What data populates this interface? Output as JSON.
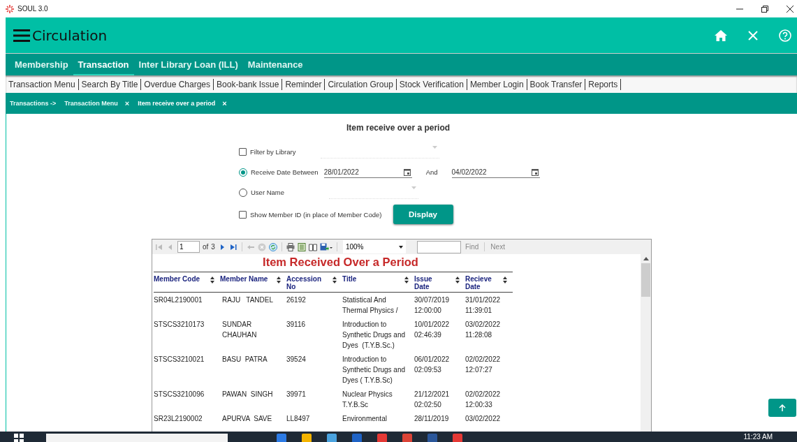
{
  "app_title": "SOUL 3.0",
  "header": {
    "title": "Circulation"
  },
  "main_tabs": [
    {
      "label": "Membership",
      "selected": false
    },
    {
      "label": "Transaction",
      "selected": true
    },
    {
      "label": "Inter Library Loan (ILL)",
      "selected": false
    },
    {
      "label": "Maintenance",
      "selected": false
    }
  ],
  "sub_tabs": [
    "Transaction Menu",
    "Search By Title",
    "Overdue Charges",
    "Book-bank Issue",
    "Reminder",
    "Circulation Group",
    "Stock Verification",
    "Member Login",
    "Book Transfer",
    "Reports"
  ],
  "breadcrumbs": [
    {
      "label": "Transactions ->"
    },
    {
      "label": "Transaction Menu",
      "close": "×"
    },
    {
      "label": "Item receive over a period",
      "close": "×"
    }
  ],
  "form": {
    "title": "Item receive over a period",
    "rows": [
      {
        "kind": "checkbox-select",
        "label": "Filter by Library",
        "checked": false
      },
      {
        "kind": "radio-dates",
        "label": "Receive Date Between",
        "selected": true,
        "from": "28/01/2022",
        "joiner": "And",
        "to": "04/02/2022"
      },
      {
        "kind": "radio-select",
        "label": "User Name",
        "selected": false
      },
      {
        "kind": "checkbox-button",
        "label": "Show Member ID (in place of Member Code)",
        "checked": false,
        "button": "Display"
      }
    ]
  },
  "report_viewer": {
    "page": "1",
    "of": "of",
    "total_pages": "3",
    "zoom": "100%",
    "find": "Find",
    "next": "Next",
    "title": "Item Received Over a Period",
    "columns": [
      "Member Code",
      "Member Name",
      "Accession No",
      "Title",
      "Issue Date",
      "Recieve Date"
    ],
    "rows": [
      [
        "SR04L2190001",
        "RAJU   TANDEL",
        "26192",
        [
          "Statistical And",
          "Thermal Physics /"
        ],
        [
          "30/07/2019",
          "12:00:00"
        ],
        [
          "31/01/2022",
          "11:39:01"
        ]
      ],
      [
        "STSCS3210173",
        "SUNDAR CHAUHAN",
        "39116",
        [
          "Introduction to",
          "Synthetic Drugs and",
          "Dyes  (T.Y.B.Sc.)"
        ],
        [
          "10/01/2022",
          "02:46:39"
        ],
        [
          "03/02/2022",
          "11:28:08"
        ]
      ],
      [
        "STSCS3210021",
        "BASU  PATRA",
        "39524",
        [
          "Introduction to",
          "Synthetic Drugs and",
          "Dyes ( T.Y.B.Sc)"
        ],
        [
          "06/01/2022",
          "02:09:53"
        ],
        [
          "02/02/2022",
          "12:07:27"
        ]
      ],
      [
        "STSCS3210096",
        "PAWAN  SINGH",
        "39971",
        [
          "Nuclear Physics",
          "T.Y.B.Sc"
        ],
        [
          "21/12/2021",
          "02:02:50"
        ],
        [
          "02/02/2022",
          "12:00:33"
        ]
      ],
      [
        "SR23L2190002",
        "APURVA  SAVE",
        "LL8497",
        [
          "Environmental"
        ],
        [
          "28/11/2019"
        ],
        [
          "03/02/2022"
        ]
      ]
    ]
  },
  "taskbar": {
    "time": "11:23 AM"
  }
}
